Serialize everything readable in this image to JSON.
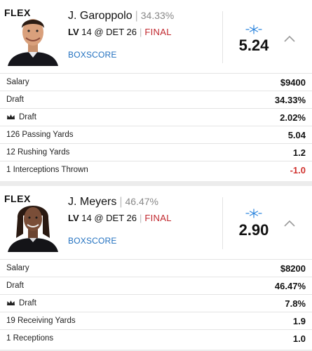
{
  "colors": {
    "final": "#c0272d",
    "link": "#1f6fbf",
    "negative": "#d0312d",
    "snowflake": "#2e86de"
  },
  "players": [
    {
      "position": "FLEX",
      "name": "J. Garoppolo",
      "own_pct": "34.33%",
      "matchup_team": "LV",
      "matchup_rest": "14 @ DET 26",
      "status": "FINAL",
      "boxscore": "BOXSCORE",
      "points": "5.24",
      "icon": "snowflake-icon",
      "rows": [
        {
          "label": "Salary",
          "value": "$9400"
        },
        {
          "label": "Draft",
          "value": "34.33%"
        },
        {
          "label": "Draft",
          "value": "2.02%",
          "icon": "crown-icon"
        },
        {
          "label": "126 Passing Yards",
          "value": "5.04"
        },
        {
          "label": "12 Rushing Yards",
          "value": "1.2"
        },
        {
          "label": "1 Interceptions Thrown",
          "value": "-1.0"
        }
      ]
    },
    {
      "position": "FLEX",
      "name": "J. Meyers",
      "own_pct": "46.47%",
      "matchup_team": "LV",
      "matchup_rest": "14 @ DET 26",
      "status": "FINAL",
      "boxscore": "BOXSCORE",
      "points": "2.90",
      "icon": "snowflake-icon",
      "rows": [
        {
          "label": "Salary",
          "value": "$8200"
        },
        {
          "label": "Draft",
          "value": "46.47%"
        },
        {
          "label": "Draft",
          "value": "7.8%",
          "icon": "crown-icon"
        },
        {
          "label": "19 Receiving Yards",
          "value": "1.9"
        },
        {
          "label": "1 Receptions",
          "value": "1.0"
        }
      ]
    }
  ]
}
